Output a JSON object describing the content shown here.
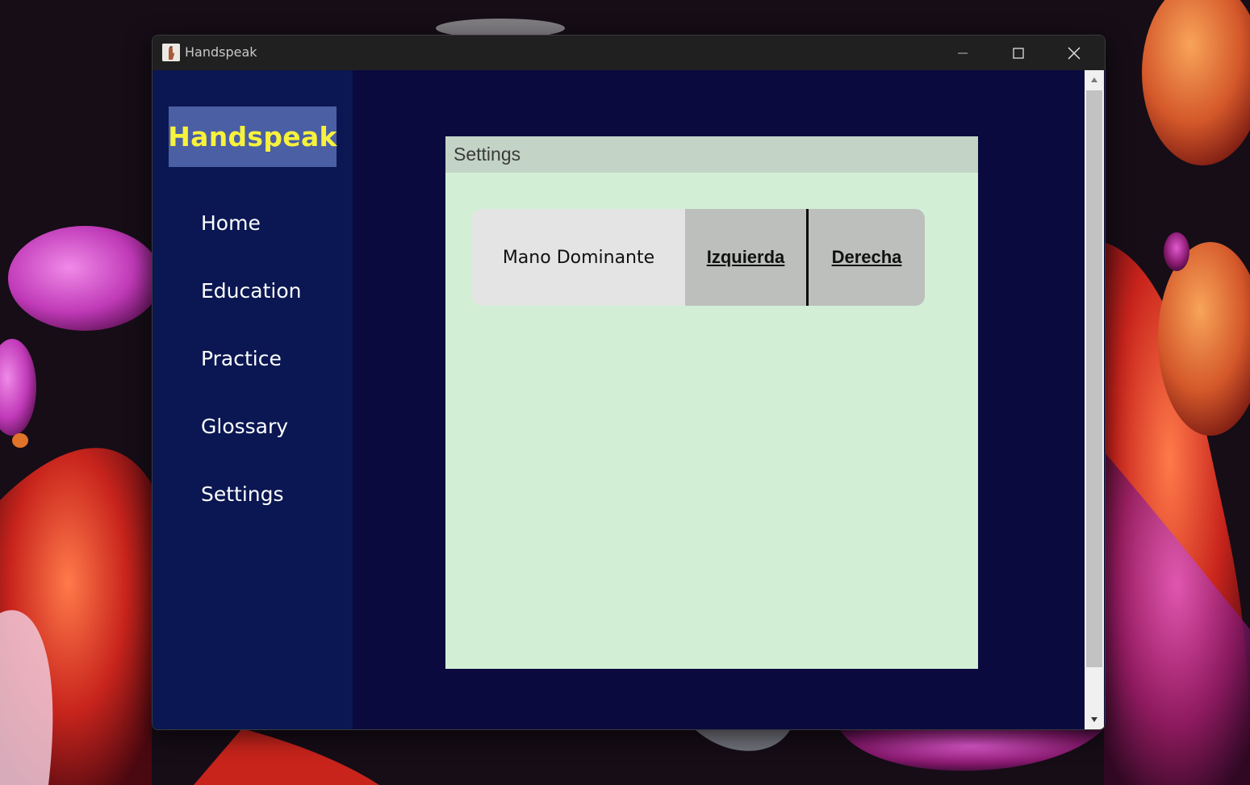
{
  "window": {
    "title": "Handspeak"
  },
  "sidebar": {
    "brand": "Handspeak",
    "items": [
      {
        "label": "Home"
      },
      {
        "label": "Education"
      },
      {
        "label": "Practice"
      },
      {
        "label": "Glossary"
      },
      {
        "label": "Settings"
      }
    ]
  },
  "settings": {
    "title": "Settings",
    "dominant_hand": {
      "label": "Mano Dominante",
      "options": [
        "Izquierda",
        "Derecha"
      ]
    }
  },
  "colors": {
    "sidebar_bg": "#0b1752",
    "content_bg": "#0b0a3e",
    "brand_bg": "#4b5fa4",
    "brand_text": "#f7f23c",
    "panel_bg": "#d2efd6",
    "panel_header_bg": "#c3d3c6",
    "option_bg": "#bcbfbb"
  },
  "icons": {
    "app": "hand-icon",
    "minimize": "minimize-icon",
    "maximize": "maximize-icon",
    "close": "close-icon"
  }
}
